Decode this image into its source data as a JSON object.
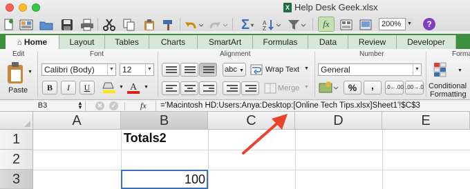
{
  "window": {
    "title": "Help Desk Geek.xlsx"
  },
  "toolbar": {
    "zoom": "200%",
    "help": "?"
  },
  "tabs": [
    {
      "label": "Home",
      "active": true
    },
    {
      "label": "Layout"
    },
    {
      "label": "Tables"
    },
    {
      "label": "Charts"
    },
    {
      "label": "SmartArt"
    },
    {
      "label": "Formulas"
    },
    {
      "label": "Data"
    },
    {
      "label": "Review"
    },
    {
      "label": "Developer"
    }
  ],
  "ribbon": {
    "groups": {
      "edit": "Edit",
      "font": "Font",
      "alignment": "Alignment",
      "number": "Number",
      "format": "Forma"
    },
    "paste_label": "Paste",
    "font_name": "Calibri (Body)",
    "font_size": "12",
    "bold": "B",
    "italic": "I",
    "underline": "U",
    "abc": "abc",
    "wrap_text": "Wrap Text",
    "merge": "Merge",
    "number_format": "General",
    "percent": "%",
    "comma": ",",
    "dec_increase": ".0←.00",
    "dec_decrease": ".00→.0",
    "conditional_formatting_1": "Conditional",
    "conditional_formatting_2": "Formatting"
  },
  "formula_bar": {
    "name_box": "B3",
    "fx": "fx",
    "formula": "='Macintosh HD:Users:Anya:Desktop:[Online Tech Tips.xlsx]Sheet1'!$C$3"
  },
  "grid": {
    "columns": [
      "A",
      "B",
      "C",
      "D",
      "E"
    ],
    "rows": [
      "1",
      "2",
      "3"
    ],
    "selected_column": "B",
    "selected_row": "3",
    "cells": {
      "B1": "Totals2",
      "B3": "100"
    }
  },
  "annotation": {
    "arrow_color": "#e8442b"
  },
  "colors": {
    "ribbon_tab_bar": "#3e8f3e",
    "selection": "#3d6fb4"
  }
}
